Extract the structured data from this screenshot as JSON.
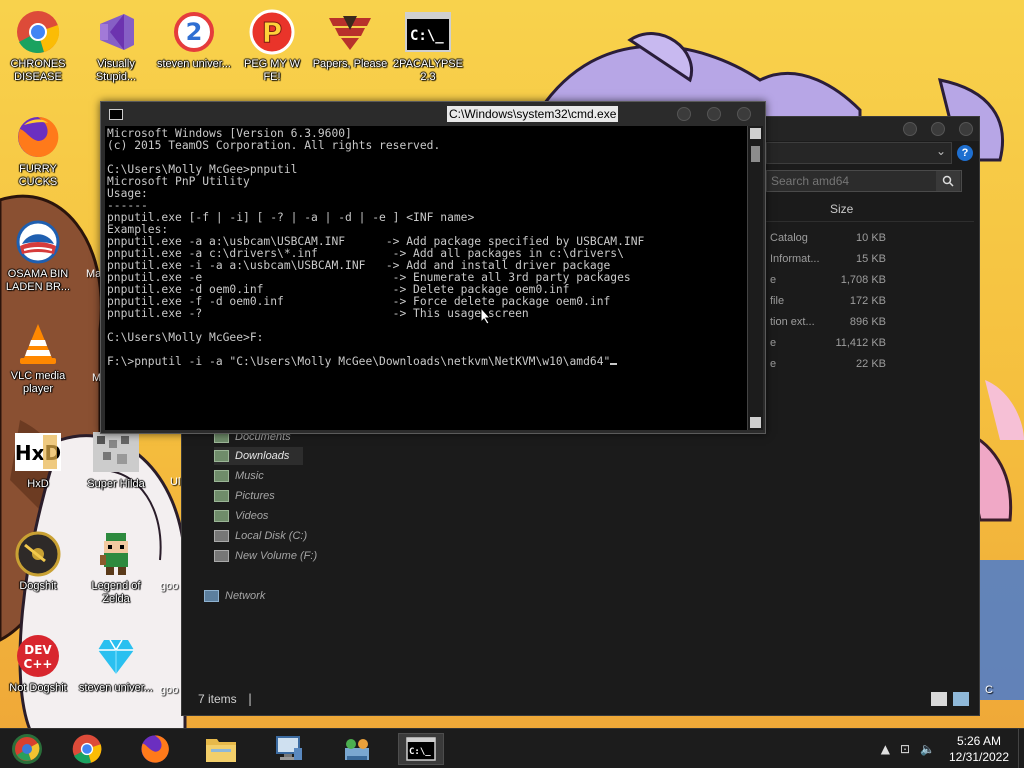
{
  "desktop": {
    "icons": [
      {
        "label": "CHRONES DISEASE"
      },
      {
        "label": "Visually Stupid..."
      },
      {
        "label": "steven univer..."
      },
      {
        "label": "PEG MY W FE!"
      },
      {
        "label": "Papers, Please"
      },
      {
        "label": "2PACALYPSE 2.3"
      },
      {
        "label": "FURRY CUCKS"
      },
      {
        "label": "OSAMA BIN LADEN BR..."
      },
      {
        "label": "VLC media player"
      },
      {
        "label": "HxD"
      },
      {
        "label": "Super Hilda"
      },
      {
        "label": "Dogshit"
      },
      {
        "label": "Legend of Zelda"
      },
      {
        "label": "Not Dogshit"
      },
      {
        "label": "steven univer..."
      },
      {
        "label": "Ma"
      },
      {
        "label": "M"
      },
      {
        "label": "goo"
      },
      {
        "label": "goo"
      },
      {
        "label": "Ul"
      },
      {
        "label": "C"
      }
    ]
  },
  "explorer": {
    "search_placeholder": "Search amd64",
    "col_size": "Size",
    "files": [
      {
        "type": "Catalog",
        "size": "10 KB"
      },
      {
        "type": "Informat...",
        "size": "15 KB"
      },
      {
        "type": "e",
        "size": "1,708 KB"
      },
      {
        "type": "file",
        "size": "172 KB"
      },
      {
        "type": "tion ext...",
        "size": "896 KB"
      },
      {
        "type": "e",
        "size": "11,412 KB"
      },
      {
        "type": "e",
        "size": "22 KB"
      }
    ],
    "nav": [
      {
        "label": "Documents"
      },
      {
        "label": "Downloads"
      },
      {
        "label": "Music"
      },
      {
        "label": "Pictures"
      },
      {
        "label": "Videos"
      },
      {
        "label": "Local Disk (C:)"
      },
      {
        "label": "New Volume (F:)"
      },
      {
        "label": "Network"
      }
    ],
    "status": "7 items"
  },
  "cmd": {
    "title": "C:\\Windows\\system32\\cmd.exe",
    "lines": [
      "Microsoft Windows [Version 6.3.9600]",
      "(c) 2015 TeamOS Corporation. All rights reserved.",
      "",
      "C:\\Users\\Molly McGee>pnputil",
      "Microsoft PnP Utility",
      "Usage:",
      "------",
      "pnputil.exe [-f | -i] [ -? | -a | -d | -e ] <INF name>",
      "Examples:",
      "pnputil.exe -a a:\\usbcam\\USBCAM.INF      -> Add package specified by USBCAM.INF",
      "pnputil.exe -a c:\\drivers\\*.inf           -> Add all packages in c:\\drivers\\",
      "pnputil.exe -i -a a:\\usbcam\\USBCAM.INF   -> Add and install driver package",
      "pnputil.exe -e                            -> Enumerate all 3rd party packages",
      "pnputil.exe -d oem0.inf                   -> Delete package oem0.inf",
      "pnputil.exe -f -d oem0.inf                -> Force delete package oem0.inf",
      "pnputil.exe -?                            -> This usage screen",
      "",
      "C:\\Users\\Molly McGee>F:",
      "",
      "F:\\>pnputil -i -a \"C:\\Users\\Molly McGee\\Downloads\\netkvm\\NetKVM\\w10\\amd64\""
    ]
  },
  "taskbar": {
    "time": "5:26 AM",
    "date": "12/31/2022"
  }
}
